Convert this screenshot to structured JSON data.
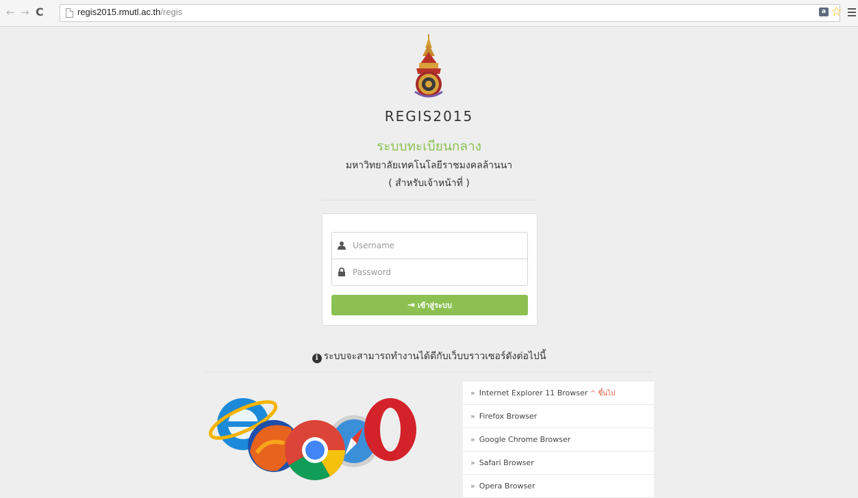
{
  "browser": {
    "url_host": "regis2015.rmutl.ac.th",
    "url_path": "/regis",
    "back_icon": "back-arrow-icon",
    "forward_icon": "forward-arrow-icon",
    "reload_icon": "reload-icon",
    "translate_icon": "translate-icon",
    "bookmark_icon": "star-icon",
    "menu_icon": "menu-icon"
  },
  "header": {
    "system_name": "REGIS2015",
    "system_title": "ระบบทะเบียนกลาง",
    "university": "มหาวิทยาลัยเทคโนโลยีราชมงคลล้านนา",
    "audience": "( สำหรับเจ้าหน้าที่ )"
  },
  "login": {
    "username_placeholder": "Username",
    "username_value": "",
    "password_placeholder": "Password",
    "password_value": "",
    "submit_label": "เข้าสู่ระบบ"
  },
  "browsers": {
    "note": "ระบบจะสามารถทำงานได้ดีกับเว็บบราวเซอร์ดังต่อไปนี้",
    "items": [
      {
        "label": "Internet Explorer 11 Browser",
        "suffix": "^ ขึ้นไป"
      },
      {
        "label": "Firefox Browser",
        "suffix": ""
      },
      {
        "label": "Google Chrome Browser",
        "suffix": ""
      },
      {
        "label": "Safari Browser",
        "suffix": ""
      },
      {
        "label": "Opera Browser",
        "suffix": ""
      }
    ]
  },
  "colors": {
    "accent_green": "#8cc152",
    "suffix_red": "#e9573f",
    "page_bg": "#eeeeee"
  }
}
